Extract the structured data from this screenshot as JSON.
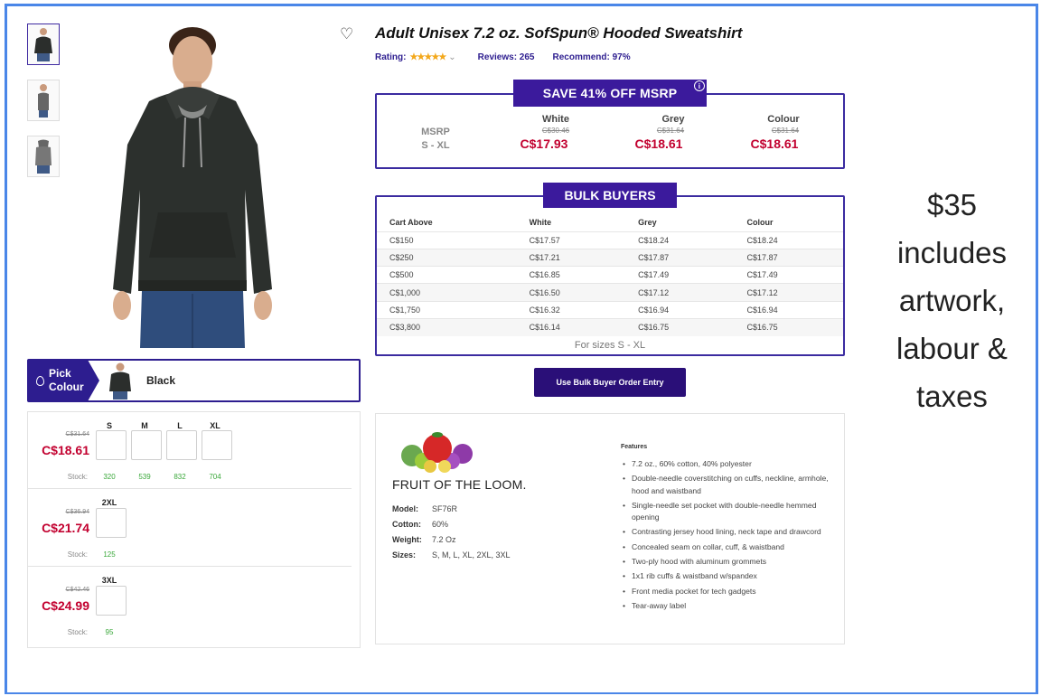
{
  "product": {
    "title": "Adult Unisex 7.2 oz. SofSpun® Hooded Sweatshirt",
    "rating_label": "Rating:",
    "reviews": "Reviews: 265",
    "recommend": "Recommend:  97%"
  },
  "save": {
    "banner": "SAVE 41% OFF MSRP",
    "msrp_label": "MSRP",
    "size_range": "S - XL",
    "columns": [
      {
        "name": "White",
        "old": "C$30.46",
        "new": "C$17.93"
      },
      {
        "name": "Grey",
        "old": "C$31.64",
        "new": "C$18.61"
      },
      {
        "name": "Colour",
        "old": "C$31.64",
        "new": "C$18.61"
      }
    ]
  },
  "bulk": {
    "banner": "BULK BUYERS",
    "headers": [
      "Cart Above",
      "White",
      "Grey",
      "Colour"
    ],
    "rows": [
      [
        "C$150",
        "C$17.57",
        "C$18.24",
        "C$18.24"
      ],
      [
        "C$250",
        "C$17.21",
        "C$17.87",
        "C$17.87"
      ],
      [
        "C$500",
        "C$16.85",
        "C$17.49",
        "C$17.49"
      ],
      [
        "C$1,000",
        "C$16.50",
        "C$17.12",
        "C$17.12"
      ],
      [
        "C$1,750",
        "C$16.32",
        "C$16.94",
        "C$16.94"
      ],
      [
        "C$3,800",
        "C$16.14",
        "C$16.75",
        "C$16.75"
      ]
    ],
    "footer": "For sizes S - XL",
    "button": "Use Bulk Buyer Order Entry"
  },
  "picker": {
    "label_line1": "Pick",
    "label_line2": "Colour",
    "selected": "Black"
  },
  "sizes": {
    "group1": {
      "headers": [
        "S",
        "M",
        "L",
        "XL"
      ],
      "old": "C$31.64",
      "new": "C$18.61",
      "stock_label": "Stock:",
      "stock": [
        "320",
        "539",
        "832",
        "704"
      ]
    },
    "group2": {
      "header": "2XL",
      "old": "C$36.94",
      "new": "C$21.74",
      "stock_label": "Stock:",
      "stock": "125"
    },
    "group3": {
      "header": "3XL",
      "old": "C$42.46",
      "new": "C$24.99",
      "stock_label": "Stock:",
      "stock": "95"
    }
  },
  "details": {
    "brand": "FRUIT OF THE LOOM.",
    "model_label": "Model:",
    "model": "SF76R",
    "cotton_label": "Cotton:",
    "cotton": "60%",
    "weight_label": "Weight:",
    "weight": "7.2 Oz",
    "sizes_label": "Sizes:",
    "sizes": "S, M, L, XL, 2XL, 3XL",
    "features_title": "Features",
    "features": [
      "7.2 oz., 60% cotton, 40% polyester",
      "Double-needle coverstitching on cuffs, neckline, armhole, hood and waistband",
      "Single-needle set pocket with double-needle hemmed opening",
      "Contrasting jersey hood lining, neck tape and drawcord",
      "Concealed seam on collar, cuff, & waistband",
      "Two-ply hood with aluminum grommets",
      "1x1 rib cuffs & waistband w/spandex",
      "Front media pocket for tech gadgets",
      "Tear-away label"
    ]
  },
  "note": {
    "lines": [
      "$35",
      "includes",
      "artwork,",
      "labour &",
      "taxes"
    ]
  },
  "colors": {
    "brand_purple": "#3b1a9c",
    "price_red": "#c2002f",
    "stock_green": "#3aa83a",
    "star": "#f3a81b"
  }
}
